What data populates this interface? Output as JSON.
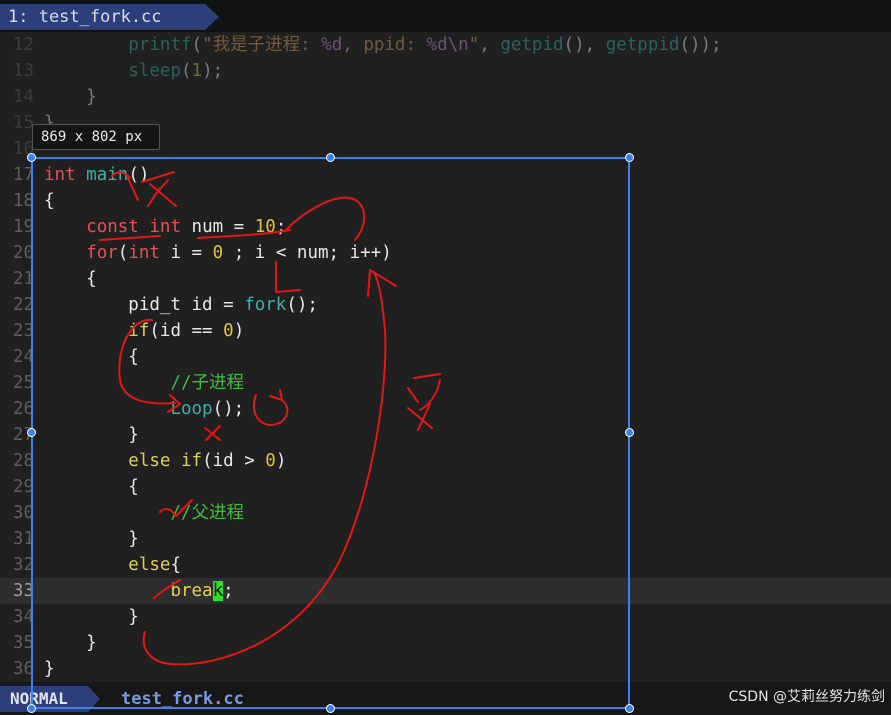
{
  "tab": {
    "label": "1: test_fork.cc"
  },
  "lines": [
    {
      "n": "12",
      "tokens": [
        {
          "t": "        "
        },
        {
          "t": "printf",
          "c": "fn"
        },
        {
          "t": "(",
          "c": "pl"
        },
        {
          "t": "\"我是子进程: ",
          "c": "str"
        },
        {
          "t": "%d",
          "c": "esc"
        },
        {
          "t": ", ppid: ",
          "c": "str"
        },
        {
          "t": "%d",
          "c": "esc"
        },
        {
          "t": "\\n",
          "c": "esc"
        },
        {
          "t": "\"",
          "c": "str"
        },
        {
          "t": ", ",
          "c": "pl"
        },
        {
          "t": "getpid",
          "c": "fn"
        },
        {
          "t": "(), ",
          "c": "pl"
        },
        {
          "t": "getppid",
          "c": "fn"
        },
        {
          "t": "());",
          "c": "pl"
        }
      ],
      "dim": true
    },
    {
      "n": "13",
      "tokens": [
        {
          "t": "        "
        },
        {
          "t": "sleep",
          "c": "fn"
        },
        {
          "t": "(",
          "c": "pl"
        },
        {
          "t": "1",
          "c": "num"
        },
        {
          "t": ");",
          "c": "pl"
        }
      ],
      "dim": true
    },
    {
      "n": "14",
      "tokens": [
        {
          "t": "    }"
        }
      ],
      "dim": true
    },
    {
      "n": "15",
      "tokens": [
        {
          "t": "}"
        }
      ],
      "dim": true
    },
    {
      "n": "16",
      "tokens": [],
      "dim": true
    },
    {
      "n": "17",
      "tokens": [
        {
          "t": "int",
          "c": "kw"
        },
        {
          "t": " "
        },
        {
          "t": "main",
          "c": "fn"
        },
        {
          "t": "()"
        }
      ]
    },
    {
      "n": "18",
      "tokens": [
        {
          "t": "{"
        }
      ]
    },
    {
      "n": "19",
      "tokens": [
        {
          "t": "    "
        },
        {
          "t": "const",
          "c": "kw"
        },
        {
          "t": " "
        },
        {
          "t": "int",
          "c": "kw"
        },
        {
          "t": " num = "
        },
        {
          "t": "10",
          "c": "num"
        },
        {
          "t": ";"
        }
      ]
    },
    {
      "n": "20",
      "tokens": [
        {
          "t": "    "
        },
        {
          "t": "for",
          "c": "kw"
        },
        {
          "t": "("
        },
        {
          "t": "int",
          "c": "kw"
        },
        {
          "t": " i = "
        },
        {
          "t": "0",
          "c": "num"
        },
        {
          "t": " ; i < num; i++)"
        }
      ]
    },
    {
      "n": "21",
      "tokens": [
        {
          "t": "    {"
        }
      ]
    },
    {
      "n": "22",
      "tokens": [
        {
          "t": "        pid_t id = "
        },
        {
          "t": "fork",
          "c": "fn"
        },
        {
          "t": "();"
        }
      ]
    },
    {
      "n": "23",
      "tokens": [
        {
          "t": "        "
        },
        {
          "t": "if",
          "c": "ty"
        },
        {
          "t": "(id == "
        },
        {
          "t": "0",
          "c": "num"
        },
        {
          "t": ")"
        }
      ]
    },
    {
      "n": "24",
      "tokens": [
        {
          "t": "        {"
        }
      ]
    },
    {
      "n": "25",
      "tokens": [
        {
          "t": "            "
        },
        {
          "t": "//子进程",
          "c": "cm"
        }
      ]
    },
    {
      "n": "26",
      "tokens": [
        {
          "t": "            "
        },
        {
          "t": "Loop",
          "c": "fn"
        },
        {
          "t": "();"
        }
      ]
    },
    {
      "n": "27",
      "tokens": [
        {
          "t": "        }"
        }
      ]
    },
    {
      "n": "28",
      "tokens": [
        {
          "t": "        "
        },
        {
          "t": "else",
          "c": "ty"
        },
        {
          "t": " "
        },
        {
          "t": "if",
          "c": "ty"
        },
        {
          "t": "(id > "
        },
        {
          "t": "0",
          "c": "num"
        },
        {
          "t": ")"
        }
      ]
    },
    {
      "n": "29",
      "tokens": [
        {
          "t": "        {"
        }
      ]
    },
    {
      "n": "30",
      "tokens": [
        {
          "t": "            "
        },
        {
          "t": "//父进程",
          "c": "cm"
        }
      ]
    },
    {
      "n": "31",
      "tokens": [
        {
          "t": "        }"
        }
      ]
    },
    {
      "n": "32",
      "tokens": [
        {
          "t": "        "
        },
        {
          "t": "else",
          "c": "ty"
        },
        {
          "t": "{"
        }
      ]
    },
    {
      "n": "33",
      "tokens": [
        {
          "t": "            "
        },
        {
          "t": "brea",
          "c": "ty"
        },
        {
          "t": "k",
          "c": "cursor"
        },
        {
          "t": ";"
        }
      ],
      "current": true
    },
    {
      "n": "34",
      "tokens": [
        {
          "t": "        }"
        }
      ]
    },
    {
      "n": "35",
      "tokens": [
        {
          "t": "    }"
        }
      ]
    },
    {
      "n": "36",
      "tokens": [
        {
          "t": "}"
        }
      ]
    }
  ],
  "selection": {
    "size_label": "869 x 802  px"
  },
  "status": {
    "mode": "NORMAL",
    "filename": "test_fork.cc"
  },
  "watermark": "CSDN @艾莉丝努力练剑",
  "colors": {
    "keyword": "#e8505b",
    "function": "#3cb1a5",
    "number": "#e0c33a",
    "comment": "#3fbf3f",
    "selection": "#3b82e8",
    "annotation": "#e01818"
  }
}
